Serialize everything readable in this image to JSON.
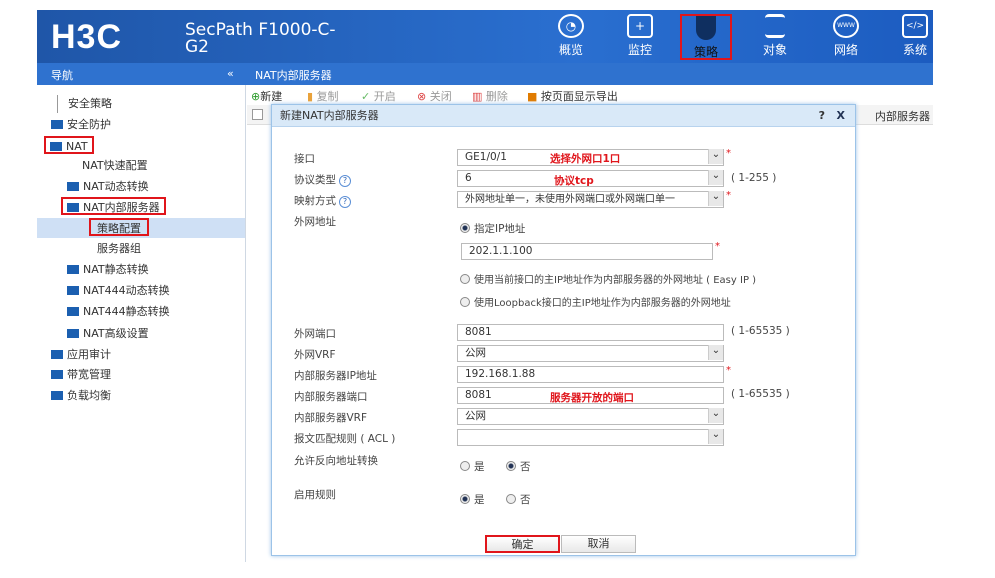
{
  "header": {
    "logo": "H3C",
    "model": "SecPath F1000-C-G2",
    "nav": [
      {
        "label": "概览",
        "icon": "gauge-icon"
      },
      {
        "label": "监控",
        "icon": "monitor-icon"
      },
      {
        "label": "策略",
        "icon": "shield-icon",
        "selected": true
      },
      {
        "label": "对象",
        "icon": "server-icon"
      },
      {
        "label": "网络",
        "icon": "internet-globe-icon"
      },
      {
        "label": "系统",
        "icon": "code-window-icon"
      }
    ]
  },
  "navbar": {
    "title": "导航",
    "collapse": "«",
    "page_title": "NAT内部服务器"
  },
  "sidebar": {
    "items": [
      "安全策略",
      "安全防护",
      "NAT",
      "NAT快速配置",
      "NAT动态转换",
      "NAT内部服务器",
      "策略配置",
      "服务器组",
      "NAT静态转换",
      "NAT444动态转换",
      "NAT444静态转换",
      "NAT高级设置",
      "应用审计",
      "带宽管理",
      "负载均衡"
    ]
  },
  "toolbar": {
    "new": "新建",
    "copy": "复制",
    "enable": "开启",
    "disable": "关闭",
    "delete": "删除",
    "export": "按页面显示导出"
  },
  "grid": {
    "col_last": "内部服务器"
  },
  "dialog": {
    "title": "新建NAT内部服务器",
    "help": "?",
    "close": "X",
    "interface_label": "接口",
    "interface_value": "GE1/0/1",
    "interface_note": "选择外网口1口",
    "protocol_label": "协议类型",
    "protocol_value": "6",
    "protocol_note": "协议tcp",
    "protocol_range": "( 1-255 )",
    "mapping_label": "映射方式",
    "mapping_value": "外网地址单一，未使用外网端口或外网端口单一",
    "public_addr_label": "外网地址",
    "opt_specify": "指定IP地址",
    "public_ip": "202.1.1.100",
    "opt_easyip": "使用当前接口的主IP地址作为内部服务器的外网地址 ( Easy IP )",
    "opt_loopback": "使用Loopback接口的主IP地址作为内部服务器的外网地址",
    "public_port_label": "外网端口",
    "public_port": "8081",
    "port_range": "( 1-65535 )",
    "public_vrf_label": "外网VRF",
    "public_vrf": "公网",
    "inner_ip_label": "内部服务器IP地址",
    "inner_ip": "192.168.1.88",
    "inner_port_label": "内部服务器端口",
    "inner_port": "8081",
    "inner_port_note": "服务器开放的端口",
    "inner_port_range": "( 1-65535 )",
    "inner_vrf_label": "内部服务器VRF",
    "inner_vrf": "公网",
    "acl_label": "报文匹配规则 ( ACL )",
    "acl": "",
    "reverse_label": "允许反向地址转换",
    "yes": "是",
    "no": "否",
    "enable_label": "启用规则",
    "ok": "确定",
    "cancel": "取消"
  }
}
